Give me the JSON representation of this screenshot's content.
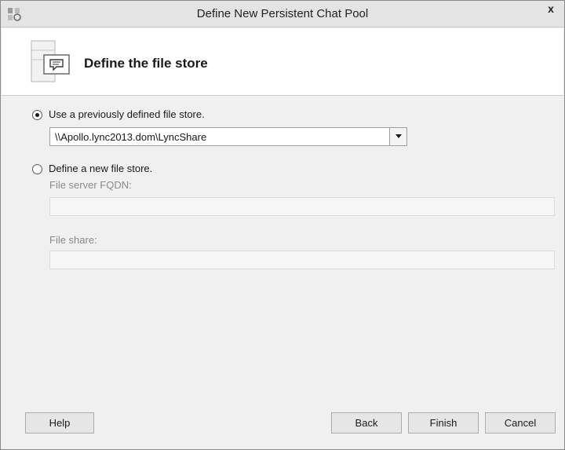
{
  "window": {
    "title": "Define New Persistent Chat Pool",
    "close_glyph": "x"
  },
  "header": {
    "title": "Define the file store",
    "icon": "server-chat-icon"
  },
  "options": {
    "existing": {
      "label": "Use a previously defined file store.",
      "selected": true,
      "dropdown_value": "\\\\Apollo.lync2013.dom\\LyncShare"
    },
    "new": {
      "label": "Define a new file store.",
      "selected": false,
      "fqdn_label": "File server FQDN:",
      "fqdn_value": "",
      "share_label": "File share:",
      "share_value": ""
    }
  },
  "buttons": {
    "help": "Help",
    "back": "Back",
    "finish": "Finish",
    "cancel": "Cancel"
  }
}
